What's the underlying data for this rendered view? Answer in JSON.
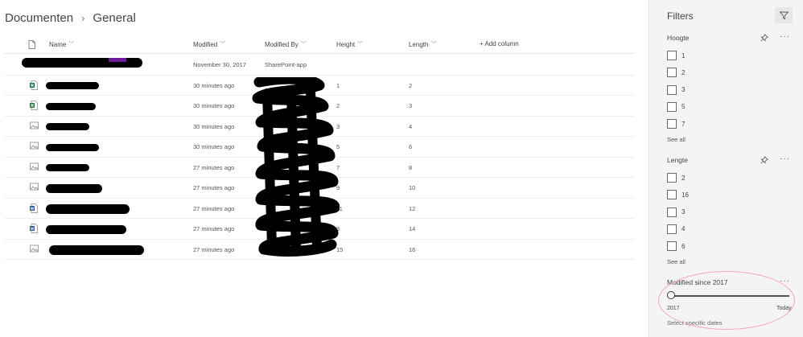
{
  "breadcrumb": {
    "root": "Documenten",
    "separator": "›",
    "current": "General"
  },
  "columns": {
    "name": "Name",
    "modified": "Modified",
    "modified_by": "Modified By",
    "height": "Height",
    "length": "Length",
    "add_column": "+ Add column"
  },
  "rows": [
    {
      "icon": "folder-icon",
      "modified": "November 30, 2017",
      "modified_by": "SharePoint-app",
      "height": "",
      "length": ""
    },
    {
      "icon": "excel-file-icon",
      "modified": "30 minutes ago",
      "modified_by": "",
      "height": "1",
      "length": "2"
    },
    {
      "icon": "excel-file-icon",
      "modified": "30 minutes ago",
      "modified_by": "",
      "height": "2",
      "length": "3"
    },
    {
      "icon": "image-file-icon",
      "modified": "30 minutes ago",
      "modified_by": "",
      "height": "3",
      "length": "4"
    },
    {
      "icon": "image-file-icon",
      "modified": "30 minutes ago",
      "modified_by": "",
      "height": "5",
      "length": "6"
    },
    {
      "icon": "image-file-icon",
      "modified": "27 minutes ago",
      "modified_by": "",
      "height": "7",
      "length": "8"
    },
    {
      "icon": "image-file-icon",
      "modified": "27 minutes ago",
      "modified_by": "",
      "height": "9",
      "length": "10"
    },
    {
      "icon": "word-file-icon",
      "modified": "27 minutes ago",
      "modified_by": "",
      "height": "11",
      "length": "12"
    },
    {
      "icon": "word-file-icon",
      "modified": "27 minutes ago",
      "modified_by": "",
      "height": "3",
      "length": "14"
    },
    {
      "icon": "image-file-icon",
      "modified": "27 minutes ago",
      "modified_by": "",
      "height": "15",
      "length": "16"
    }
  ],
  "panel": {
    "title": "Filters",
    "hoogte": {
      "title": "Hoogte",
      "options": [
        "1",
        "2",
        "3",
        "5",
        "7"
      ],
      "see_all": "See all"
    },
    "lengte": {
      "title": "Lengte",
      "options": [
        "2",
        "16",
        "3",
        "4",
        "6"
      ],
      "see_all": "See all"
    },
    "modified": {
      "title": "Modified since 2017",
      "min_label": "2017",
      "max_label": "Today",
      "slider_value": 0,
      "specific": "Select specific dates"
    },
    "more": "···"
  },
  "colors": {
    "accent": "#6a1b9a",
    "annotation": "#f2a6b1",
    "excel": "#1e7145",
    "word": "#2b579a"
  }
}
